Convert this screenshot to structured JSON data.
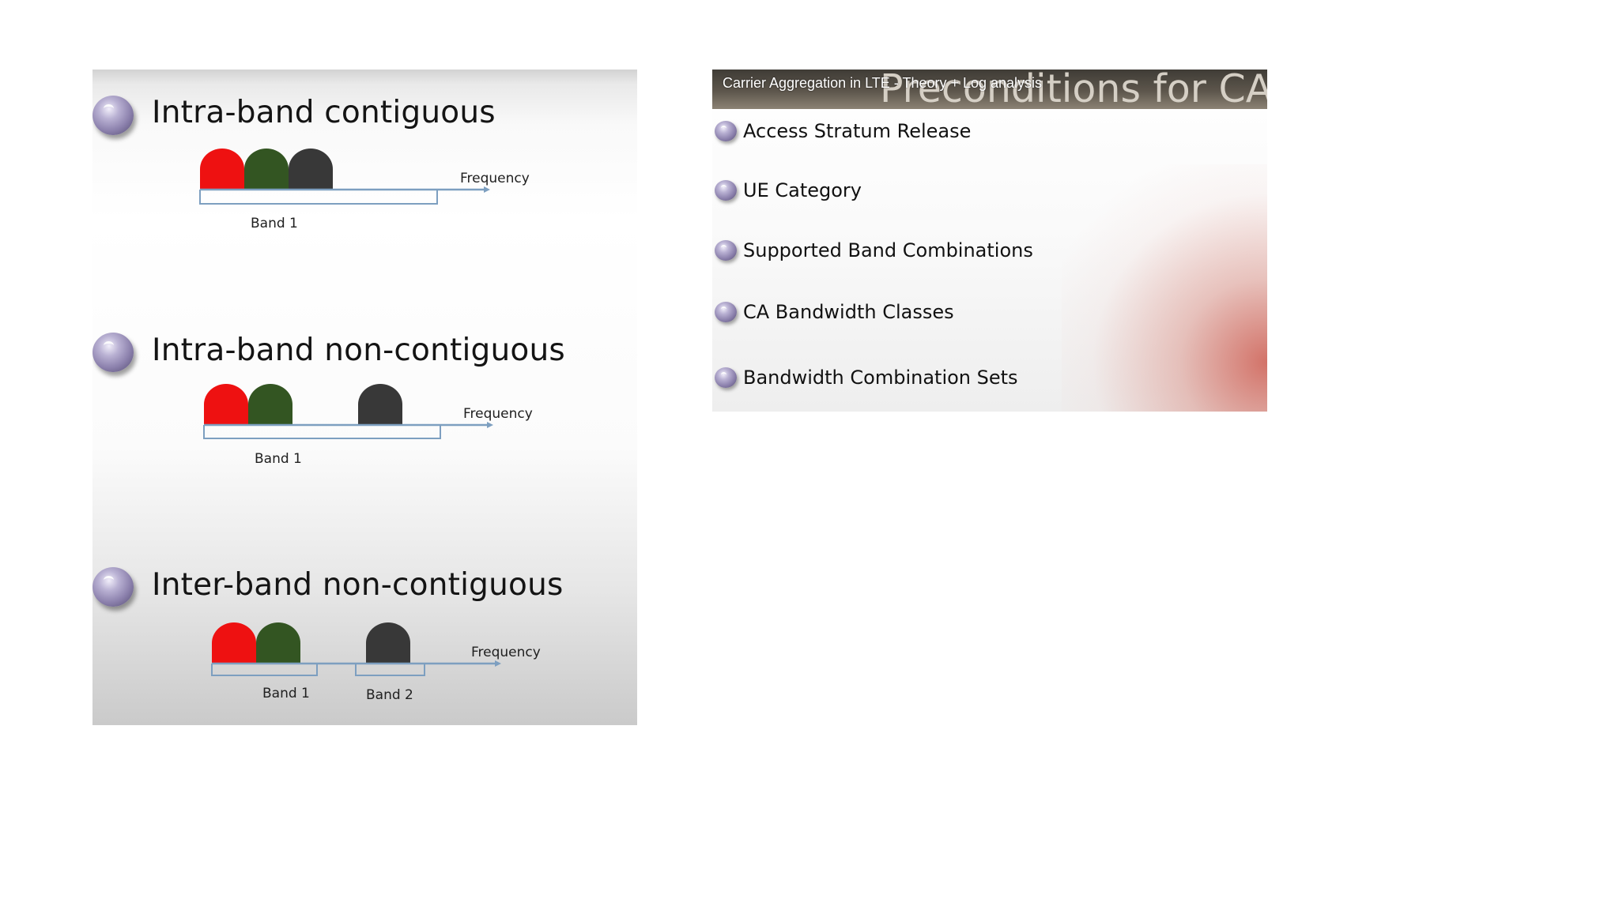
{
  "left_slide": {
    "sections": [
      {
        "title": "Intra-band contiguous",
        "frequency_label": "Frequency",
        "bands": [
          "Band 1"
        ]
      },
      {
        "title": "Intra-band non-contiguous",
        "frequency_label": "Frequency",
        "bands": [
          "Band 1"
        ]
      },
      {
        "title": "Inter-band non-contiguous",
        "frequency_label": "Frequency",
        "bands": [
          "Band 1",
          "Band 2"
        ]
      }
    ],
    "carrier_colors": {
      "red": "#ee1111",
      "green": "#335522",
      "dark": "#383838"
    },
    "axis_color": "#7d9fc0"
  },
  "right_slide": {
    "video_title": "Carrier Aggregation in LTE - Theory + Log analysis",
    "heading": "Preconditions for CA",
    "items": [
      "Access Stratum Release",
      "UE Category",
      "Supported Band Combinations",
      "CA Bandwidth Classes",
      "Bandwidth Combination Sets"
    ],
    "accent_color": "#cd5c50"
  }
}
